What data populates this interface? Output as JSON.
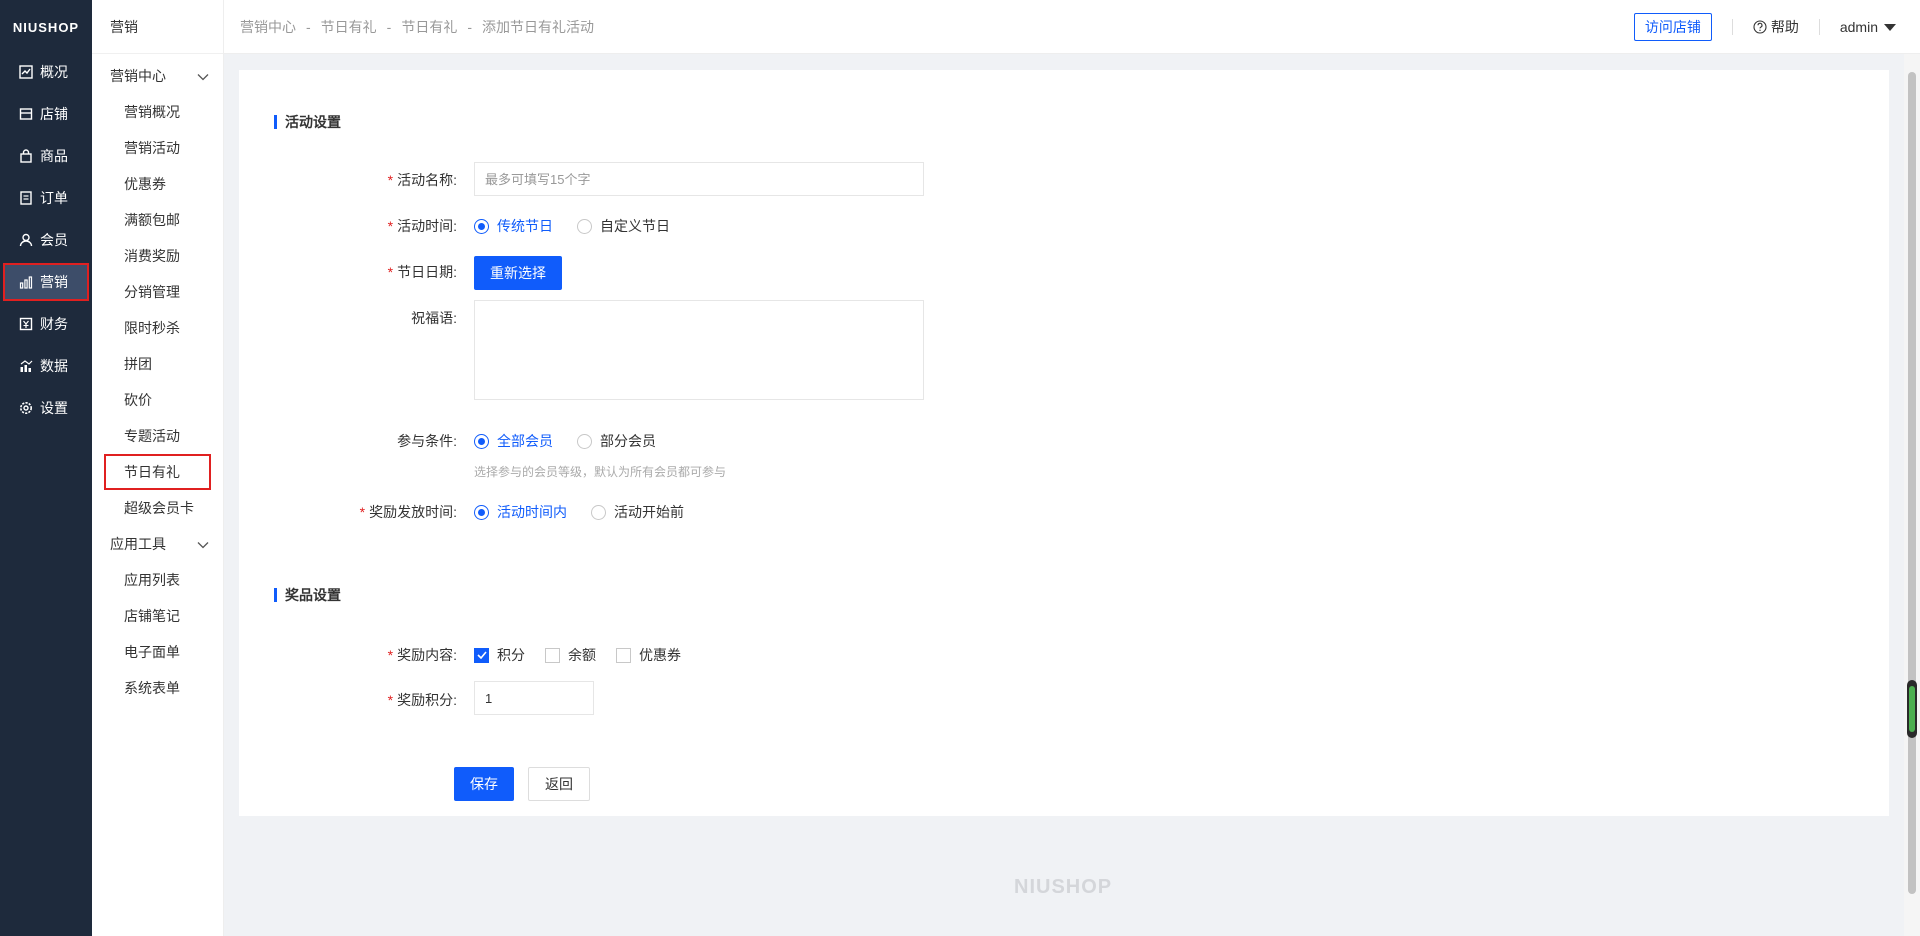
{
  "brand": "NIUSHOP",
  "footer_brand": "NIUSHOP",
  "colors": {
    "primary": "#105cfb",
    "nav_bg": "#1e2a3c",
    "highlight": "#e02020"
  },
  "nav": [
    {
      "label": "概况",
      "icon": "chart-line-icon"
    },
    {
      "label": "店铺",
      "icon": "store-icon"
    },
    {
      "label": "商品",
      "icon": "bag-icon"
    },
    {
      "label": "订单",
      "icon": "list-icon"
    },
    {
      "label": "会员",
      "icon": "user-icon"
    },
    {
      "label": "营销",
      "icon": "bar-chart-icon",
      "active": true
    },
    {
      "label": "财务",
      "icon": "yen-icon"
    },
    {
      "label": "数据",
      "icon": "data-icon"
    },
    {
      "label": "设置",
      "icon": "gear-icon"
    }
  ],
  "subnav": {
    "header": "营销",
    "group1": "营销中心",
    "items1": [
      "营销概况",
      "营销活动",
      "优惠券",
      "满额包邮",
      "消费奖励",
      "分销管理",
      "限时秒杀",
      "拼团",
      "砍价",
      "专题活动",
      "节日有礼",
      "超级会员卡"
    ],
    "group2": "应用工具",
    "items2": [
      "应用列表",
      "店铺笔记",
      "电子面单",
      "系统表单"
    ]
  },
  "breadcrumb": [
    "营销中心",
    "节日有礼",
    "节日有礼",
    "添加节日有礼活动"
  ],
  "breadcrumb_sep": "-",
  "topbar": {
    "visit": "访问店铺",
    "help": "帮助",
    "user": "admin"
  },
  "form": {
    "section1": "活动设置",
    "name_label": "活动名称:",
    "name_placeholder": "最多可填写15个字",
    "time_label": "活动时间:",
    "time_opt1": "传统节日",
    "time_opt2": "自定义节日",
    "date_label": "节日日期:",
    "date_btn": "重新选择",
    "greeting_label": "祝福语:",
    "cond_label": "参与条件:",
    "cond_opt1": "全部会员",
    "cond_opt2": "部分会员",
    "cond_hint": "选择参与的会员等级，默认为所有会员都可参与",
    "reward_time_label": "奖励发放时间:",
    "reward_time_opt1": "活动时间内",
    "reward_time_opt2": "活动开始前",
    "section2": "奖品设置",
    "reward_content_label": "奖励内容:",
    "reward_opt1": "积分",
    "reward_opt2": "余额",
    "reward_opt3": "优惠券",
    "points_label": "奖励积分:",
    "points_value": "1",
    "req": "*",
    "save": "保存",
    "back": "返回"
  }
}
